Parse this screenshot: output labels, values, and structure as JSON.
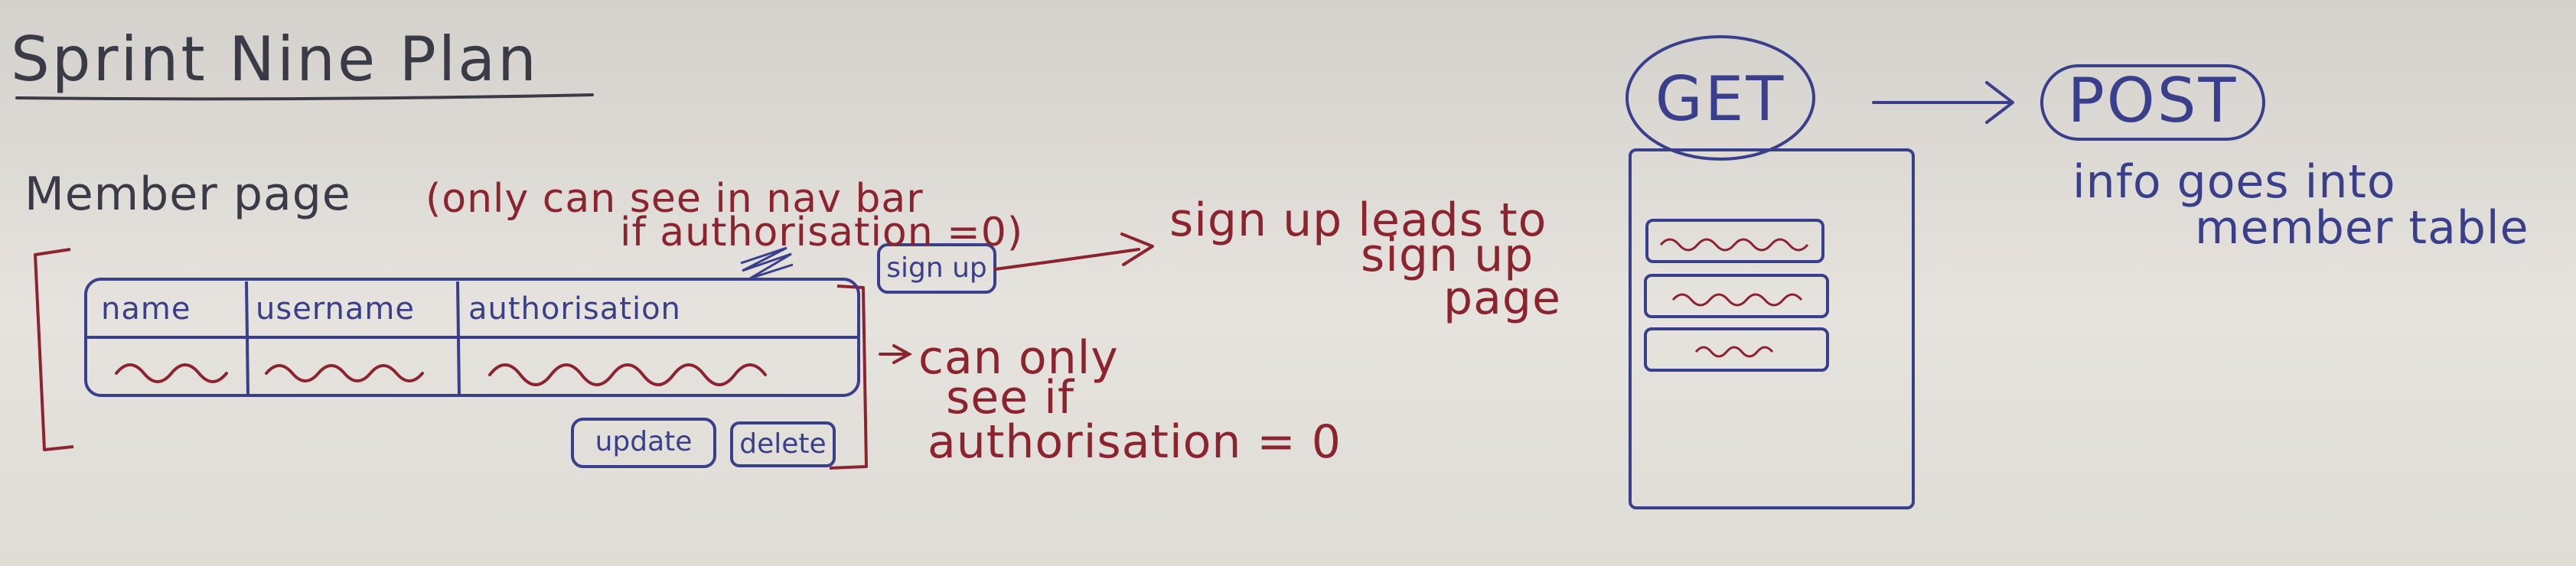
{
  "title": "Sprint Nine Plan",
  "member_page": {
    "heading": "Member page",
    "note_line1": "(only can see in nav bar",
    "note_line2": "if authorisation =0)"
  },
  "table": {
    "columns": [
      "name",
      "username",
      "authorisation"
    ],
    "buttons": {
      "update": "update",
      "delete": "delete"
    }
  },
  "signup_button": "sign up",
  "signup_note": {
    "line1": "sign up leads to",
    "line2": "sign up",
    "line3": "page"
  },
  "buttons_note": {
    "line1": "can only",
    "line2": "see if",
    "line3": "authorisation = 0"
  },
  "flow": {
    "get": "GET",
    "post": "POST"
  },
  "post_note": {
    "line1": "info goes into",
    "line2": "member table"
  },
  "colors": {
    "ink_navy": "#3a3f8c",
    "ink_red": "#8c2430",
    "ink_dark": "#3b3b48",
    "board": "#e0ddd8"
  }
}
